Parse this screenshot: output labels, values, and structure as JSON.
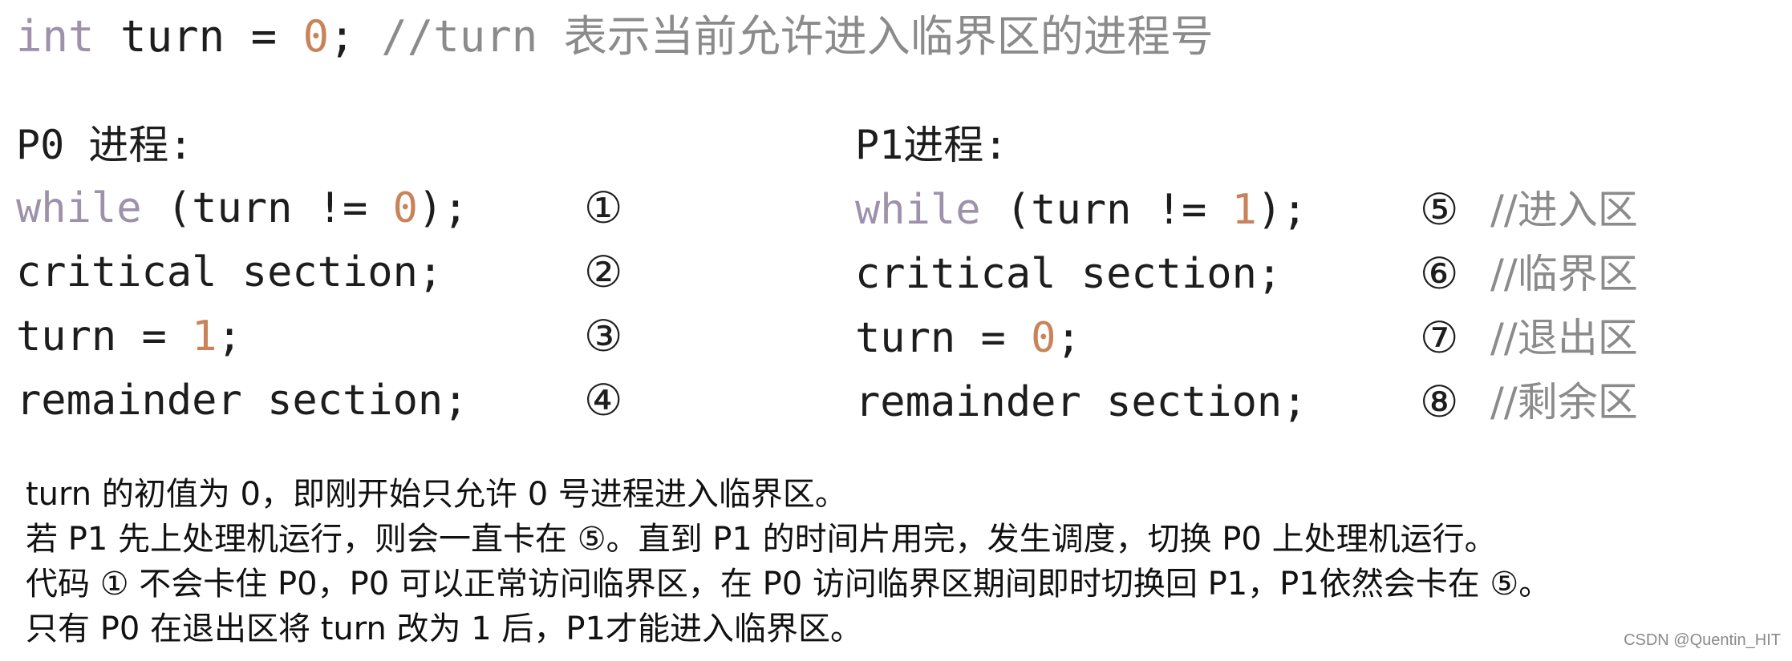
{
  "top_line": {
    "kw": "int",
    "code_a": " turn = ",
    "num": "0",
    "code_b": "; ",
    "comment": "//turn 表示当前允许进入临界区的进程号"
  },
  "p0": {
    "heading": "P0 进程:",
    "lines": [
      {
        "kw": "while",
        "pre": " (turn != ",
        "num": "0",
        "post": ");",
        "marker": "①"
      },
      {
        "kw": "",
        "pre": "critical section;",
        "num": "",
        "post": "",
        "marker": "②"
      },
      {
        "kw": "",
        "pre": "turn = ",
        "num": "1",
        "post": ";",
        "marker": "③"
      },
      {
        "kw": "",
        "pre": "remainder section;",
        "num": "",
        "post": "",
        "marker": "④"
      }
    ]
  },
  "p1": {
    "heading": "P1进程:",
    "lines": [
      {
        "kw": "while",
        "pre": " (turn != ",
        "num": "1",
        "post": ");",
        "marker": "⑤",
        "comment": "//进入区"
      },
      {
        "kw": "",
        "pre": "critical section;",
        "num": "",
        "post": "",
        "marker": "⑥",
        "comment": "//临界区"
      },
      {
        "kw": "",
        "pre": "turn = ",
        "num": "0",
        "post": ";",
        "marker": "⑦",
        "comment": "//退出区"
      },
      {
        "kw": "",
        "pre": "remainder section;",
        "num": "",
        "post": "",
        "marker": "⑧",
        "comment": "//剩余区"
      }
    ]
  },
  "explanation": [
    "turn 的初值为 0，即刚开始只允许 0 号进程进入临界区。",
    "若 P1 先上处理机运行，则会一直卡在 ⑤。直到 P1 的时间片用完，发生调度，切换 P0 上处理机运行。",
    "代码 ① 不会卡住 P0，P0 可以正常访问临界区，在 P0 访问临界区期间即时切换回 P1，P1依然会卡在 ⑤。",
    "只有 P0 在退出区将 turn 改为 1 后，P1才能进入临界区。"
  ],
  "watermark": "CSDN @Quentin_HIT",
  "colors": {
    "keyword": "#9e91ab",
    "number": "#c9835a",
    "comment": "#8b8b8b",
    "text": "#1d1d1d"
  }
}
